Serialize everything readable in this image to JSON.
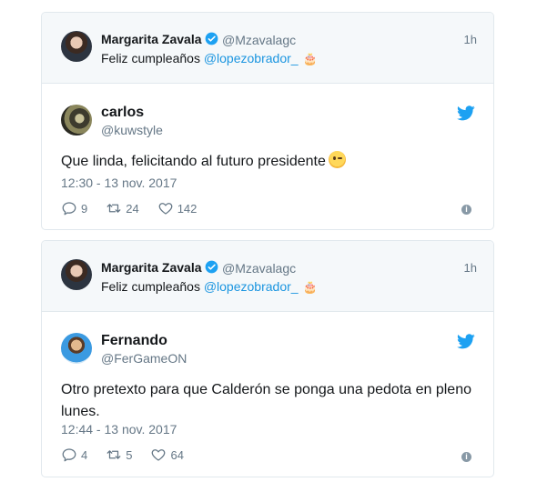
{
  "tweets": [
    {
      "quoted": {
        "name": "Margarita Zavala",
        "handle": "@Mzavalagc",
        "time": "1h",
        "text_prefix": "Feliz cumpleaños ",
        "mention": "@lopezobrador_",
        "emoji": "🎂"
      },
      "name": "carlos",
      "handle": "@kuwstyle",
      "text": "Que linda, felicitando al futuro presidente",
      "emoji": "wink-emoji",
      "date": "12:30 - 13 nov. 2017",
      "replies": "9",
      "retweets": "24",
      "likes": "142"
    },
    {
      "quoted": {
        "name": "Margarita Zavala",
        "handle": "@Mzavalagc",
        "time": "1h",
        "text_prefix": "Feliz cumpleaños ",
        "mention": "@lopezobrador_",
        "emoji": "🎂"
      },
      "name": "Fernando",
      "handle": "@FerGameON",
      "text": "Otro pretexto para que Calderón se ponga una pedota en pleno lunes.",
      "date": "12:44 - 13 nov. 2017",
      "replies": "4",
      "retweets": "5",
      "likes": "64"
    }
  ],
  "colors": {
    "accent": "#1da1f2",
    "mention": "#1b95e0",
    "muted": "#657786",
    "quoted_bg": "#f5f8fa",
    "border": "#e1e8ed"
  }
}
